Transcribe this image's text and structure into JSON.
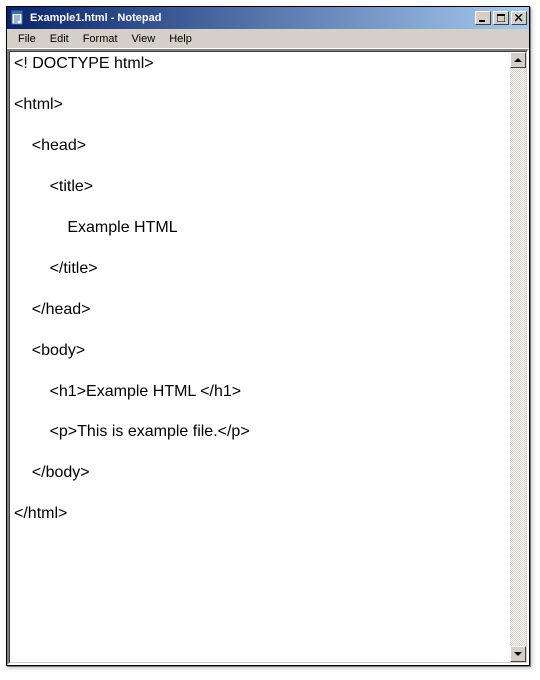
{
  "window": {
    "title": "Example1.html - Notepad"
  },
  "menu": {
    "file": "File",
    "edit": "Edit",
    "format": "Format",
    "view": "View",
    "help": "Help"
  },
  "editor": {
    "content": "<! DOCTYPE html>\n\n<html>\n\n    <head>\n\n        <title>\n\n            Example HTML\n\n        </title>\n\n    </head>\n\n    <body>\n\n        <h1>Example HTML </h1>\n\n        <p>This is example file.</p>\n\n    </body>\n\n</html>"
  }
}
